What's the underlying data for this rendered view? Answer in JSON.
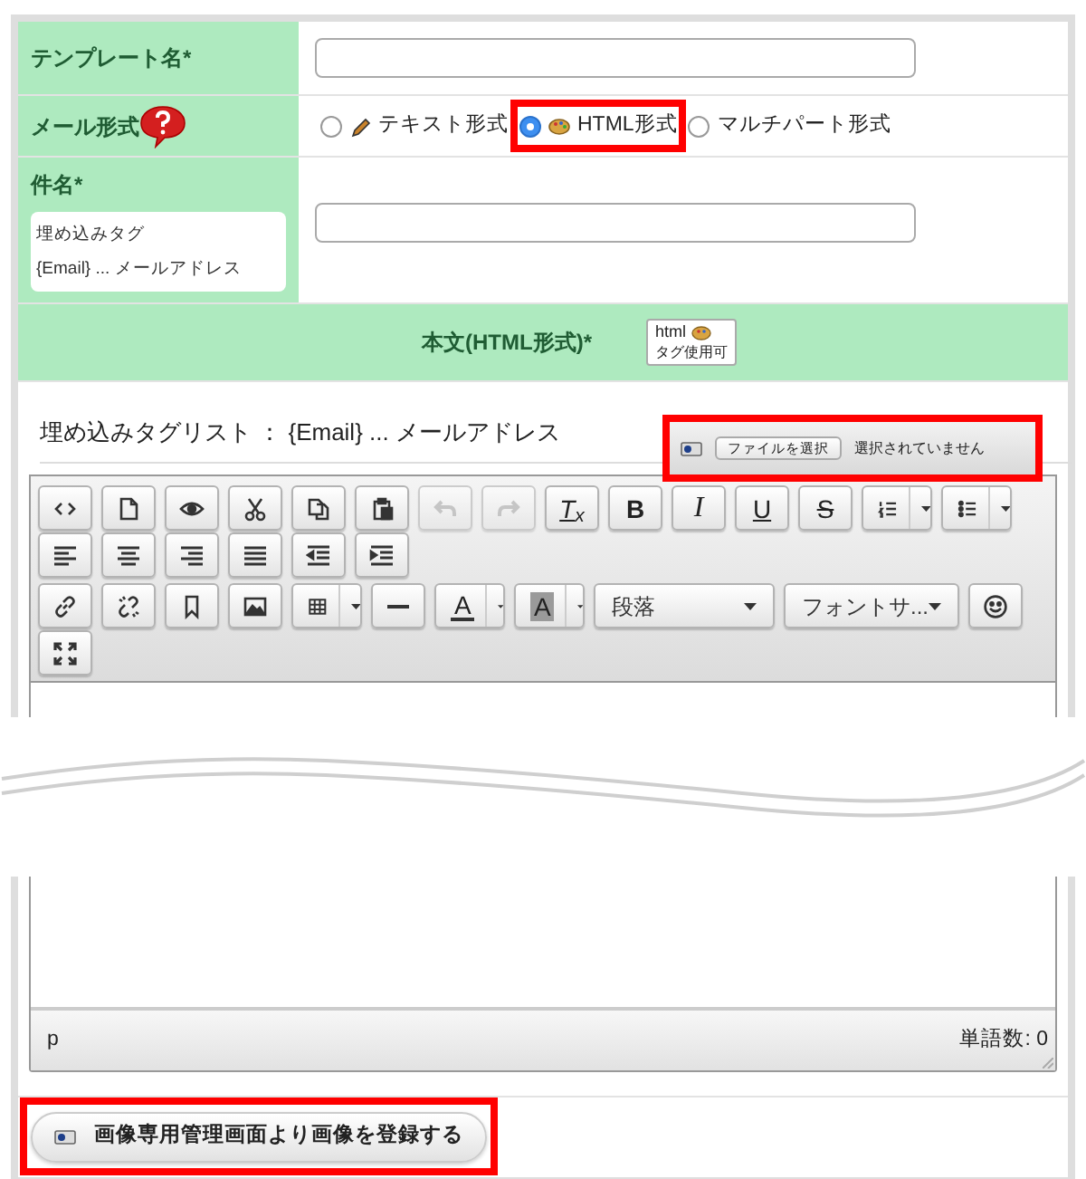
{
  "form": {
    "rows": [
      {
        "kind": "text_input",
        "label": "テンプレート名*"
      },
      {
        "kind": "radio_group",
        "label": "メール形式",
        "help": true,
        "options": [
          {
            "label": "テキスト形式",
            "selected": false,
            "highlighted": false
          },
          {
            "label": "HTML形式",
            "selected": true,
            "highlighted": true
          },
          {
            "label": "マルチパート形式",
            "selected": false,
            "highlighted": false
          }
        ]
      },
      {
        "kind": "text_input",
        "label": "件名*",
        "note": {
          "title": "埋め込みタグ",
          "text": "{Email} ... メールアドレス"
        }
      }
    ]
  },
  "body": {
    "title": "本文(HTML形式)*",
    "badge": [
      "html",
      "タグ使用可"
    ],
    "tag_list": "埋め込みタグリスト ： {Email} ... メールアドレス",
    "file_input": {
      "button": "ファイルを選択",
      "status": "選択されていません",
      "highlighted": true
    },
    "toolbar": [
      [
        {
          "kind": "icon",
          "disabled": false
        },
        {
          "kind": "icon",
          "disabled": false
        },
        {
          "kind": "icon",
          "disabled": false
        },
        {
          "kind": "icon",
          "disabled": false
        },
        {
          "kind": "icon",
          "disabled": false
        },
        {
          "kind": "icon",
          "disabled": false
        },
        {
          "kind": "icon",
          "disabled": true
        },
        {
          "kind": "icon",
          "disabled": true
        },
        {
          "kind": "text",
          "label": "T$_{x}$",
          "disabled": false
        },
        {
          "kind": "text",
          "label": "B",
          "disabled": false
        },
        {
          "kind": "text",
          "label": "I",
          "disabled": false
        },
        {
          "kind": "text",
          "label": "U",
          "disabled": false
        },
        {
          "kind": "text",
          "label": "S",
          "disabled": false
        },
        {
          "kind": "split",
          "disabled": false
        },
        {
          "kind": "split",
          "disabled": false
        }
      ],
      [
        {
          "kind": "icon",
          "disabled": false
        },
        {
          "kind": "icon",
          "disabled": false
        },
        {
          "kind": "icon",
          "disabled": false
        },
        {
          "kind": "icon",
          "disabled": false
        },
        {
          "kind": "icon",
          "disabled": false
        },
        {
          "kind": "icon",
          "disabled": false
        }
      ],
      [
        {
          "kind": "icon",
          "disabled": false
        },
        {
          "kind": "icon",
          "disabled": false
        },
        {
          "kind": "icon",
          "disabled": false
        },
        {
          "kind": "icon",
          "disabled": false
        },
        {
          "kind": "split",
          "disabled": false
        },
        {
          "kind": "icon",
          "disabled": false
        },
        {
          "kind": "font_color",
          "label": "A",
          "disabled": false
        },
        {
          "kind": "back_color",
          "label": "A",
          "disabled": false
        },
        {
          "kind": "select",
          "label": "段落",
          "disabled": false
        },
        {
          "kind": "select",
          "label": "フォントサ...",
          "disabled": false
        },
        {
          "kind": "icon",
          "disabled": false
        }
      ],
      [
        {
          "kind": "icon",
          "disabled": false
        }
      ]
    ],
    "status_bar": {
      "path": "p",
      "word_count": "単語数: 0"
    }
  },
  "register_button": {
    "label": "画像専用管理画面より画像を登録する",
    "highlighted": true
  }
}
